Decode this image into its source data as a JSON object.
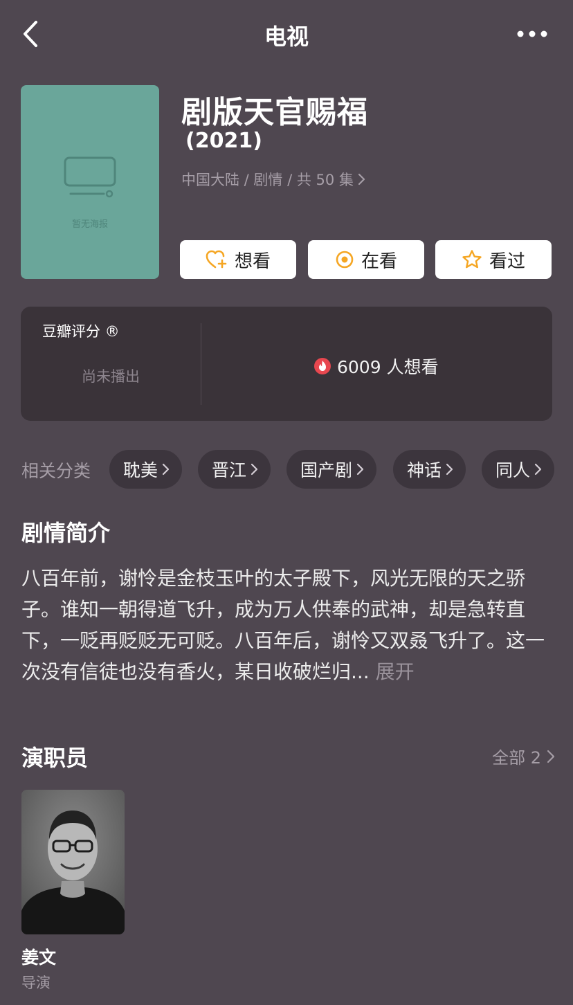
{
  "nav": {
    "title": "电视"
  },
  "poster": {
    "placeholder_text": "暂无海报",
    "bg_color": "#6aa69a"
  },
  "show": {
    "title": "剧版天官赐福",
    "year": "(2021)",
    "meta": "中国大陆 / 剧情 / 共 50 集"
  },
  "actions": {
    "want": "想看",
    "watching": "在看",
    "watched": "看过",
    "accent_color": "#f5a623"
  },
  "rating": {
    "label": "豆瓣评分 ®",
    "value": "尚未播出",
    "want_count": "6009 人想看"
  },
  "categories": {
    "label": "相关分类",
    "tags": [
      "耽美",
      "晋江",
      "国产剧",
      "神话",
      "同人"
    ]
  },
  "synopsis": {
    "title": "剧情简介",
    "text": "八百年前，谢怜是金枝玉叶的太子殿下，风光无限的天之骄子。谁知一朝得道飞升，成为万人供奉的武神，却是急转直下，一贬再贬贬无可贬。八百年后，谢怜又双叒飞升了。这一次没有信徒也没有香火，某日收破烂归...",
    "expand": "展开"
  },
  "cast": {
    "title": "演职员",
    "all_label": "全部 2",
    "members": [
      {
        "name": "姜文",
        "role": "导演"
      }
    ]
  }
}
